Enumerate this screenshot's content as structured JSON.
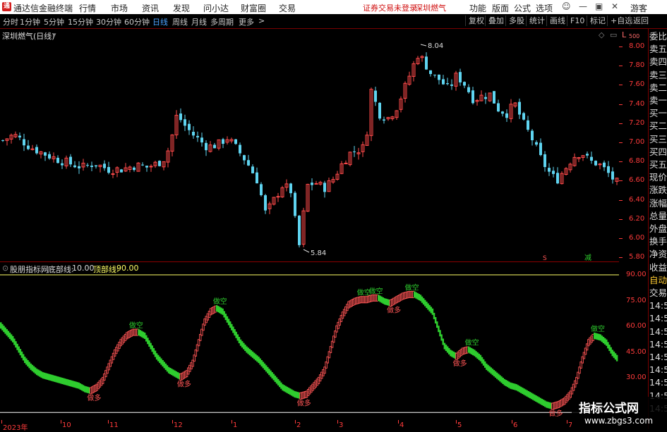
{
  "titlebar": {
    "app_title": "通达信金融终端",
    "menus": [
      "行情",
      "市场",
      "资讯",
      "发现",
      "问小达",
      "财富圈",
      "交易"
    ],
    "notice": "证券交易未登录",
    "stock": "深圳燃气",
    "right_menus": [
      "功能",
      "版面",
      "公式",
      "选项"
    ],
    "user": "游客"
  },
  "periods": [
    "分时",
    "1分钟",
    "5分钟",
    "15分钟",
    "30分钟",
    "60分钟",
    "日线",
    "周线",
    "月线",
    "多周期",
    "更多"
  ],
  "selected_period": "日线",
  "toolbar": [
    "复权",
    "叠加",
    "多股",
    "统计",
    "画线",
    "F10",
    "标记",
    "+自选",
    "返回"
  ],
  "main_chart": {
    "title": "深圳燃气(日线)",
    "high_label": "8.04",
    "low_label": "5.84",
    "price_ticks": [
      "8.00",
      "7.80",
      "7.60",
      "7.40",
      "7.20",
      "7.00",
      "6.80",
      "6.60",
      "6.40",
      "6.20",
      "6.00",
      "5.80"
    ],
    "scale_top": "L",
    "scale_sub": "500",
    "marker_s": "S",
    "marker_j": "减"
  },
  "indicator": {
    "name": "股朋指标网",
    "line1_label": "底部线:",
    "line1_value": "10.00",
    "line2_label": "顶部线:",
    "line2_value": "90.00",
    "ticks": [
      "90.00",
      "75.00",
      "60.00",
      "45.00",
      "30.00"
    ],
    "buy_label": "做多",
    "sell_label": "做空",
    "series": [
      62,
      58,
      54,
      48,
      42,
      38,
      35,
      33,
      32,
      31,
      30,
      29,
      28,
      27,
      25,
      24,
      26,
      30,
      38,
      46,
      52,
      56,
      58,
      58,
      56,
      50,
      44,
      40,
      36,
      34,
      32,
      34,
      40,
      52,
      64,
      70,
      72,
      70,
      64,
      58,
      52,
      48,
      45,
      42,
      38,
      34,
      30,
      26,
      24,
      22,
      21,
      22,
      26,
      30,
      36,
      48,
      60,
      68,
      74,
      76,
      77,
      77,
      78,
      78,
      76,
      75,
      77,
      79,
      80,
      80,
      78,
      74,
      70,
      60,
      50,
      46,
      44,
      47,
      48,
      46,
      43,
      38,
      35,
      32,
      29,
      27,
      26,
      24,
      22,
      20,
      18,
      16,
      15,
      16,
      18,
      22,
      30,
      42,
      52,
      56,
      55,
      52,
      46,
      42
    ]
  },
  "side_panel": [
    "委比",
    "卖五",
    "卖四",
    "卖三",
    "卖二",
    "卖一",
    "买一",
    "买二",
    "买三",
    "买四",
    "买五",
    "现价",
    "涨跌",
    "涨幅",
    "总量",
    "外盘",
    "换手",
    "净资",
    "收益",
    "自动",
    "交易",
    "14:5",
    "14:5",
    "14:5",
    "14:5",
    "14:5",
    "14:5",
    "14:5",
    "14:5",
    "14:5"
  ],
  "x_axis": [
    "2023年",
    "10",
    "11",
    "12",
    "1",
    "2",
    "3",
    "4",
    "5",
    "6",
    "7"
  ],
  "watermark": {
    "title": "指标公式网",
    "url": "www.zbgs3.com"
  },
  "colors": {
    "up": "#ff4a4a",
    "down": "#5fd4f0",
    "ind_up": "#ff5555",
    "ind_down": "#2ecc2e",
    "axis": "#ff3b3b",
    "line": "#ffff66"
  }
}
